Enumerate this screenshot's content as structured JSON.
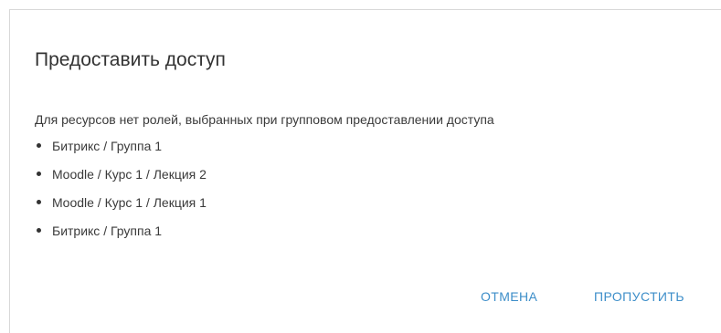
{
  "dialog": {
    "title": "Предоставить доступ",
    "message": "Для ресурсов нет ролей, выбранных при групповом предоставлении доступа",
    "resources": [
      {
        "label": "Битрикс / Группа 1"
      },
      {
        "label": "Moodle / Курс 1 / Лекция 2"
      },
      {
        "label": "Moodle / Курс 1 / Лекция 1"
      },
      {
        "label": "Битрикс / Группа 1"
      }
    ],
    "buttons": {
      "cancel_label": "ОТМЕНА",
      "skip_label": "ПРОПУСТИТЬ"
    }
  },
  "colors": {
    "accent": "#3d8ec9",
    "text": "#3a3a3a",
    "title": "#333333",
    "border": "#d8d8d8",
    "background": "#ffffff"
  }
}
